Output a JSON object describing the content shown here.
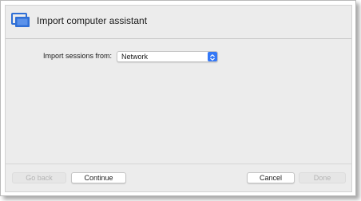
{
  "dialog": {
    "title": "Import computer assistant",
    "icon": "monitor-icon",
    "accent_color": "#3478f6"
  },
  "form": {
    "import_label": "Import sessions from:",
    "source_select": {
      "value": "Network"
    }
  },
  "buttons": {
    "back": "Go back",
    "continue": "Continue",
    "cancel": "Cancel",
    "done": "Done"
  }
}
